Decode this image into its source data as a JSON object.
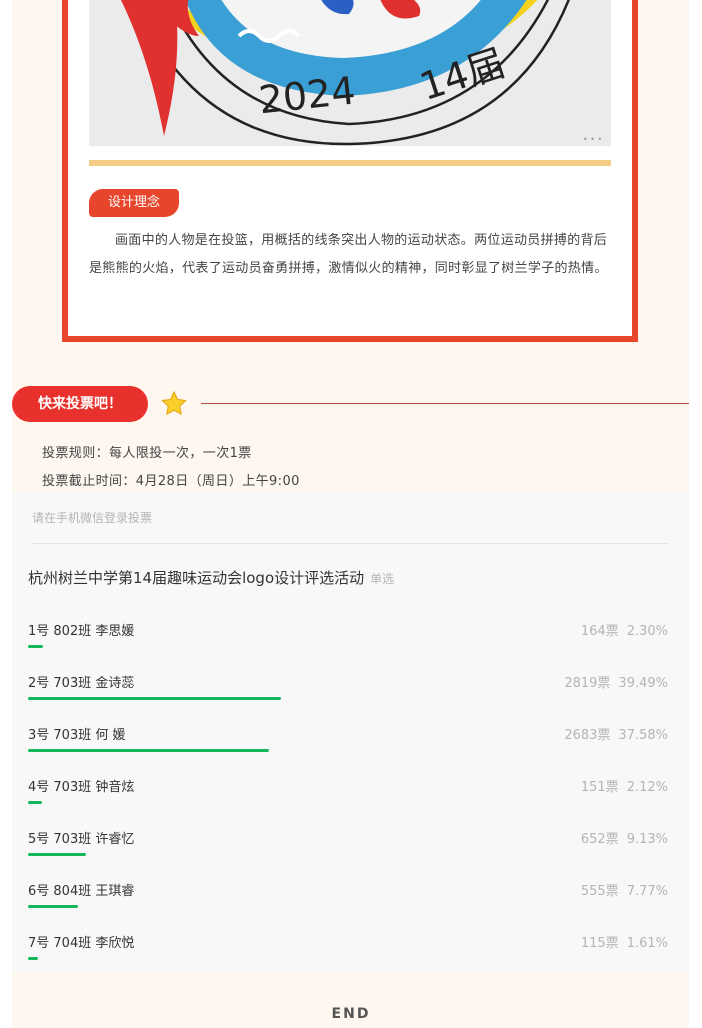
{
  "artwork": {
    "painted_text": "2024 14届"
  },
  "concept": {
    "tag": "设计理念",
    "text": "画面中的人物是在投篮，用概括的线条突出人物的运动状态。两位运动员拼搏的背后是熊熊的火焰，代表了运动员奋勇拼搏，激情似火的精神，同时彰显了树兰学子的热情。"
  },
  "vote_header": {
    "label": "快来投票吧！",
    "rule": "投票规则：每人限投一次，一次1票",
    "deadline": "投票截止时间：4月28日（周日）上午9:00"
  },
  "poll": {
    "login_hint": "请在手机微信登录投票",
    "title": "杭州树兰中学第14届趣味运动会logo设计评选活动",
    "type": "单选",
    "options": [
      {
        "name": "1号 802班 李思媛",
        "votes": "164票",
        "percent": "2.30%",
        "share": 0.023
      },
      {
        "name": "2号 703班 金诗蕊",
        "votes": "2819票",
        "percent": "39.49%",
        "share": 0.3949
      },
      {
        "name": "3号 703班 何 媛",
        "votes": "2683票",
        "percent": "37.58%",
        "share": 0.3758
      },
      {
        "name": "4号 703班 钟音炫",
        "votes": "151票",
        "percent": "2.12%",
        "share": 0.0212
      },
      {
        "name": "5号 703班 许睿忆",
        "votes": "652票",
        "percent": "9.13%",
        "share": 0.0913
      },
      {
        "name": "6号 804班 王琪睿",
        "votes": "555票",
        "percent": "7.77%",
        "share": 0.0777
      },
      {
        "name": "7号 704班 李欣悦",
        "votes": "115票",
        "percent": "1.61%",
        "share": 0.0161
      }
    ],
    "bar_color": "#12b85a"
  },
  "footer": {
    "end": "END"
  },
  "colors": {
    "accent_red": "#e8462c",
    "divider_gold": "#f6cd85",
    "page_bg": "#fdf7f0"
  },
  "icons": {
    "star": "star-icon"
  }
}
